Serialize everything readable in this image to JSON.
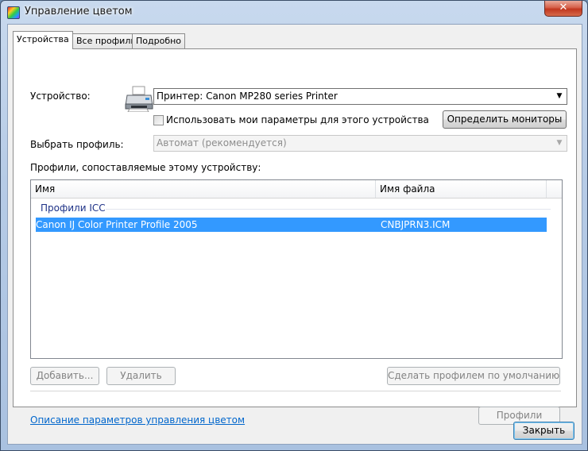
{
  "window": {
    "title": "Управление цветом",
    "close_label": "✕"
  },
  "tabs": [
    {
      "label": "Устройства",
      "active": true
    },
    {
      "label": "Все профили",
      "active": false
    },
    {
      "label": "Подробно",
      "active": false
    }
  ],
  "device": {
    "label": "Устройство:",
    "selected": "Принтер: Canon MP280 series Printer",
    "use_my_settings_label": "Использовать мои параметры для этого устройства",
    "use_my_settings_checked": false,
    "identify_monitors_label": "Определить мониторы"
  },
  "profile_select": {
    "label": "Выбрать профиль:",
    "selected": "Автомат (рекомендуется)"
  },
  "associated": {
    "label": "Профили, сопоставляемые этому устройству:",
    "columns": [
      "Имя",
      "Имя файла"
    ],
    "group": "Профили ICC",
    "rows": [
      {
        "name": "Canon IJ Color Printer Profile 2005",
        "file": "CNBJPRN3.ICM"
      }
    ]
  },
  "buttons": {
    "add": "Добавить...",
    "remove": "Удалить",
    "set_default": "Сделать профилем по умолчанию",
    "profiles": "Профили",
    "close": "Закрыть"
  },
  "link": {
    "text": "Описание параметров управления цветом"
  }
}
